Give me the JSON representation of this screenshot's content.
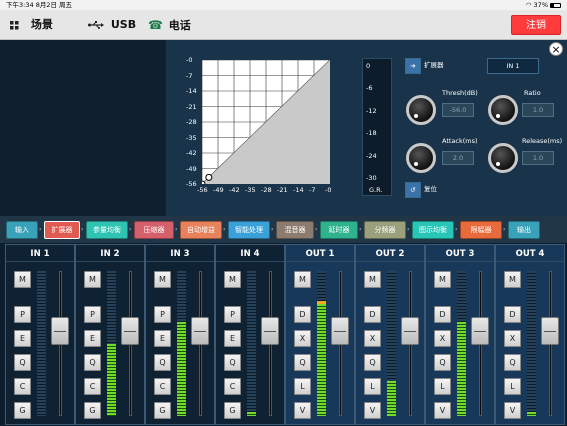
{
  "status": {
    "time": "下午3:34",
    "date": "8月2日 周五",
    "battery": "37%",
    "battery_level": 0.37
  },
  "topbar": {
    "scene_label": "场景",
    "usb_label": "USB",
    "phone_label": "电话",
    "logout_label": "注销"
  },
  "graph": {
    "y_ticks": [
      "-0",
      "-7",
      "-14",
      "-21",
      "-28",
      "-35",
      "-42",
      "-49",
      "-56"
    ],
    "x_ticks": [
      "-56",
      "-49",
      "-42",
      "-35",
      "-28",
      "-21",
      "-14",
      "-7",
      "-0"
    ],
    "points": [
      [
        -56,
        -56
      ],
      [
        -53,
        -53
      ]
    ]
  },
  "gr_meter": {
    "ticks": [
      "0",
      "-6",
      "-12",
      "-18",
      "-24",
      "-30"
    ],
    "label": "G.R."
  },
  "expander": {
    "arrow_icon": "arrow-right-icon",
    "title": "扩展器",
    "channel": "IN 1",
    "thresh_label": "Thresh(dB)",
    "thresh_value": "-56.0",
    "ratio_label": "Ratio",
    "ratio_value": "1.0",
    "attack_label": "Attack(ms)",
    "attack_value": "2.0",
    "release_label": "Release(ms)",
    "release_value": "1.0",
    "reset_label": "复位"
  },
  "chain": [
    {
      "label": "输入",
      "color": "#3aa2b8"
    },
    {
      "label": "扩展器",
      "color": "#e05a52"
    },
    {
      "label": "参量均衡",
      "color": "#2ec4b1"
    },
    {
      "label": "压缩器",
      "color": "#d4606b"
    },
    {
      "label": "自动增益",
      "color": "#e8825a"
    },
    {
      "label": "智能处理",
      "color": "#3aa0d8"
    },
    {
      "label": "混音器",
      "color": "#8c7c6f"
    },
    {
      "label": "延时器",
      "color": "#2fb38e"
    },
    {
      "label": "分频器",
      "color": "#9aa07c"
    },
    {
      "label": "图示均衡",
      "color": "#27c6b6"
    },
    {
      "label": "限幅器",
      "color": "#e96b3c"
    },
    {
      "label": "输出",
      "color": "#3aa2b8"
    }
  ],
  "inputs": [
    {
      "name": "IN 1",
      "buttons": [
        "M",
        "P",
        "E",
        "Q",
        "C",
        "G"
      ],
      "level": 0.0
    },
    {
      "name": "IN 2",
      "buttons": [
        "M",
        "P",
        "E",
        "Q",
        "C",
        "G"
      ],
      "level": 0.5
    },
    {
      "name": "IN 3",
      "buttons": [
        "M",
        "P",
        "E",
        "Q",
        "C",
        "G"
      ],
      "level": 0.65
    },
    {
      "name": "IN 4",
      "buttons": [
        "M",
        "P",
        "E",
        "Q",
        "C",
        "G"
      ],
      "level": 0.03
    }
  ],
  "outputs": [
    {
      "name": "OUT 1",
      "buttons": [
        "M",
        "D",
        "X",
        "Q",
        "L",
        "V"
      ],
      "level": 0.79
    },
    {
      "name": "OUT 2",
      "buttons": [
        "M",
        "D",
        "X",
        "Q",
        "L",
        "V"
      ],
      "level": 0.24
    },
    {
      "name": "OUT 3",
      "buttons": [
        "M",
        "D",
        "X",
        "Q",
        "L",
        "V"
      ],
      "level": 0.65
    },
    {
      "name": "OUT 4",
      "buttons": [
        "M",
        "D",
        "X",
        "Q",
        "L",
        "V"
      ],
      "level": 0.03
    }
  ]
}
